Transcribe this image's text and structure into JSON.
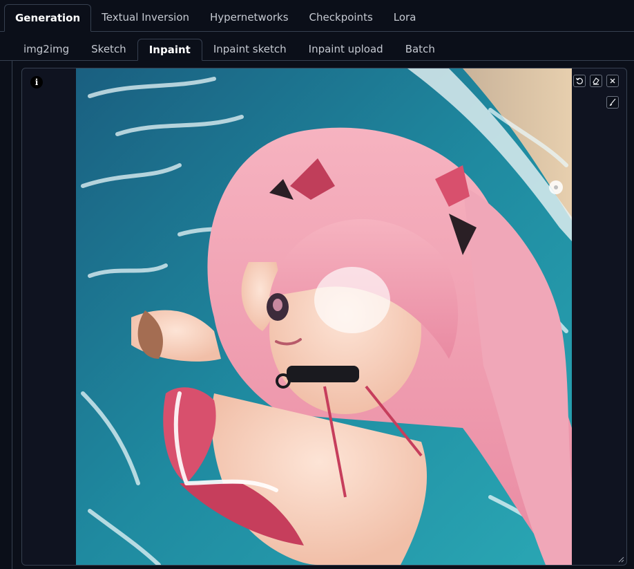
{
  "top_tabs": [
    {
      "label": "Generation",
      "active": true
    },
    {
      "label": "Textual Inversion",
      "active": false
    },
    {
      "label": "Hypernetworks",
      "active": false
    },
    {
      "label": "Checkpoints",
      "active": false
    },
    {
      "label": "Lora",
      "active": false
    }
  ],
  "sub_tabs": [
    {
      "label": "img2img",
      "active": false
    },
    {
      "label": "Sketch",
      "active": false
    },
    {
      "label": "Inpaint",
      "active": true
    },
    {
      "label": "Inpaint sketch",
      "active": false
    },
    {
      "label": "Inpaint upload",
      "active": false
    },
    {
      "label": "Batch",
      "active": false
    }
  ],
  "canvas": {
    "info_glyph": "i",
    "tools": {
      "undo": "undo-icon",
      "clear": "eraser-icon",
      "remove": "close-icon",
      "brush": "brush-icon"
    }
  },
  "colors": {
    "background": "#0b0f19",
    "border": "#374151",
    "water": "#1f7f96",
    "hair": "#f2a3b4"
  }
}
